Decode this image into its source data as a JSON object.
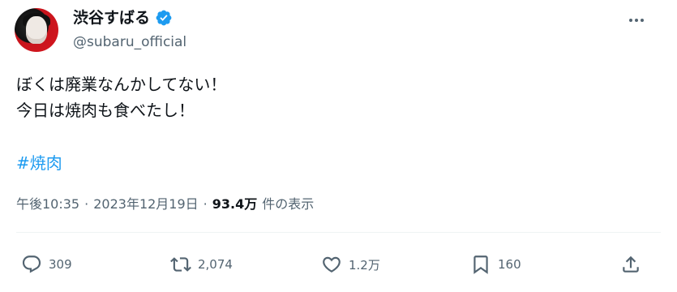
{
  "author": {
    "display_name": "渋谷すばる",
    "handle": "@subaru_official"
  },
  "tweet": {
    "lines": [
      "ぼくは廃業なんかしてない！",
      "今日は焼肉も食べたし！"
    ],
    "hashtag": "#焼肉"
  },
  "meta": {
    "time": "午後10:35",
    "separator": "·",
    "date": "2023年12月19日",
    "views_count": "93.4万",
    "views_label": "件の表示"
  },
  "actions": {
    "replies": "309",
    "retweets": "2,074",
    "likes": "1.2万",
    "bookmarks": "160"
  },
  "colors": {
    "accent": "#1d9bf0",
    "muted": "#536471",
    "text": "#0f1419",
    "verified": "#1d9bf0"
  }
}
